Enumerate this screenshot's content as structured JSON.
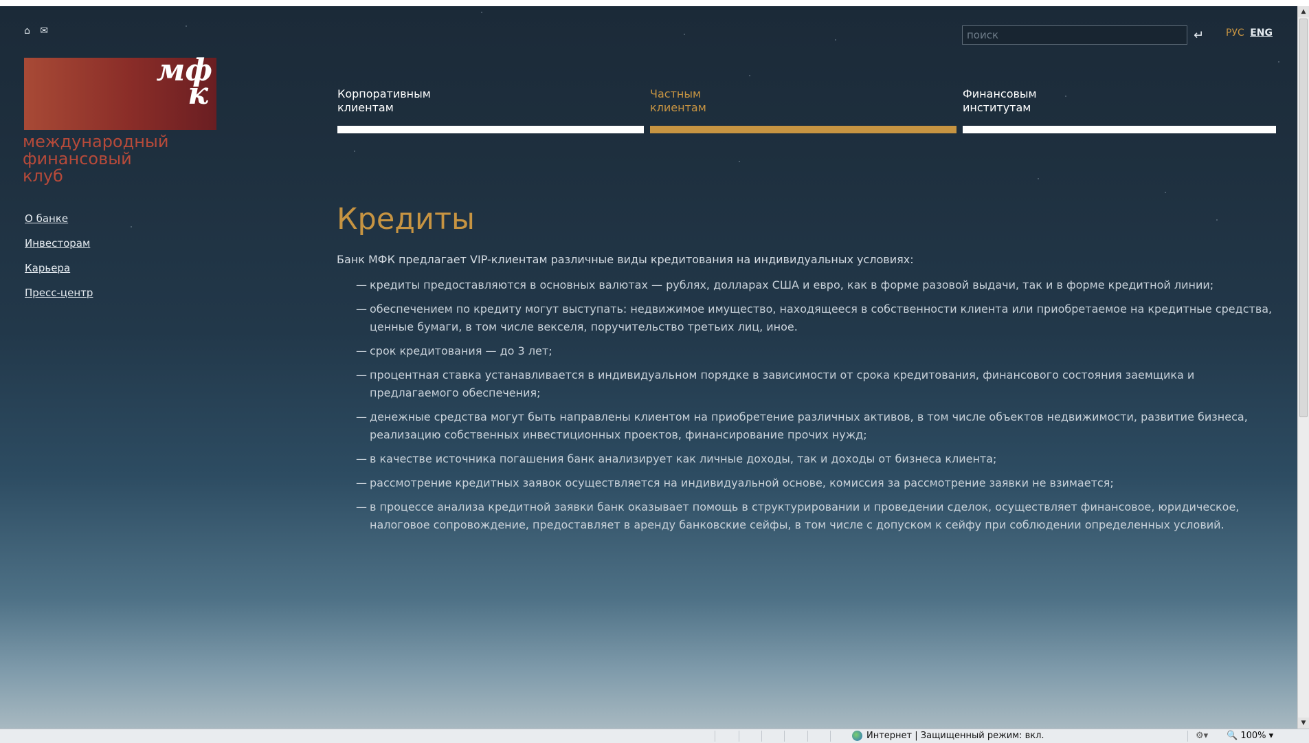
{
  "header": {
    "icons": [
      "home-icon",
      "mail-icon"
    ],
    "search_placeholder": "поиск",
    "enter_icon": "↵",
    "lang_ru": "РУС",
    "lang_en": "ENG"
  },
  "logo": {
    "mark": "мфк",
    "text_line1": "международный",
    "text_line2": "финансовый",
    "text_line3": "клуб"
  },
  "sidebar": {
    "items": [
      {
        "label": "О банке"
      },
      {
        "label": "Инвесторам"
      },
      {
        "label": "Карьера"
      },
      {
        "label": "Пресс-центр"
      }
    ]
  },
  "tabs": [
    {
      "line1": "Корпоративным",
      "line2": "клиентам",
      "active": false
    },
    {
      "line1": "Частным",
      "line2": "клиентам",
      "active": true
    },
    {
      "line1": "Финансовым",
      "line2": "институтам",
      "active": false
    }
  ],
  "main": {
    "title": "Кредиты",
    "intro": "Банк МФК предлагает VIP-клиентам различные виды кредитования на индивидуальных условиях:",
    "dash": "—",
    "items": [
      "кредиты предоставляются в основных валютах — рублях, долларах США и евро, как в форме разовой выдачи, так и в форме кредитной линии;",
      "обеспечением по кредиту могут выступать: недвижимое имущество, находящееся в собственности клиента или приобретаемое на кредитные средства, ценные бумаги, в том числе векселя, поручительство третьих лиц, иное.",
      "срок кредитования — до 3 лет;",
      "процентная ставка устанавливается в индивидуальном порядке в зависимости от срока кредитования, финансового состояния заемщика и предлагаемого обеспечения;",
      "денежные средства могут быть направлены клиентом на приобретение различных активов, в том числе объектов недвижимости, развитие бизнеса, реализацию собственных инвестиционных проектов, финансирование прочих нужд;",
      "в качестве источника погашения банк анализирует как личные доходы, так и доходы от бизнеса клиента;",
      "рассмотрение кредитных заявок осуществляется на индивидуальной основе, комиссия за рассмотрение заявки не взимается;",
      "в процессе анализа кредитной заявки банк оказывает помощь в структурировании и проведении сделок, осуществляет финансовое, юридическое, налоговое сопровождение, предоставляет в аренду банковские сейфы, в том числе с допуском к сейфу при соблюдении определенных условий."
    ]
  },
  "statusbar": {
    "zone_text": "Интернет | Защищенный режим: вкл.",
    "zoom": "100%"
  },
  "colors": {
    "accent": "#c79442",
    "logo_red": "#8a2d28",
    "text": "#c8d1d9"
  }
}
